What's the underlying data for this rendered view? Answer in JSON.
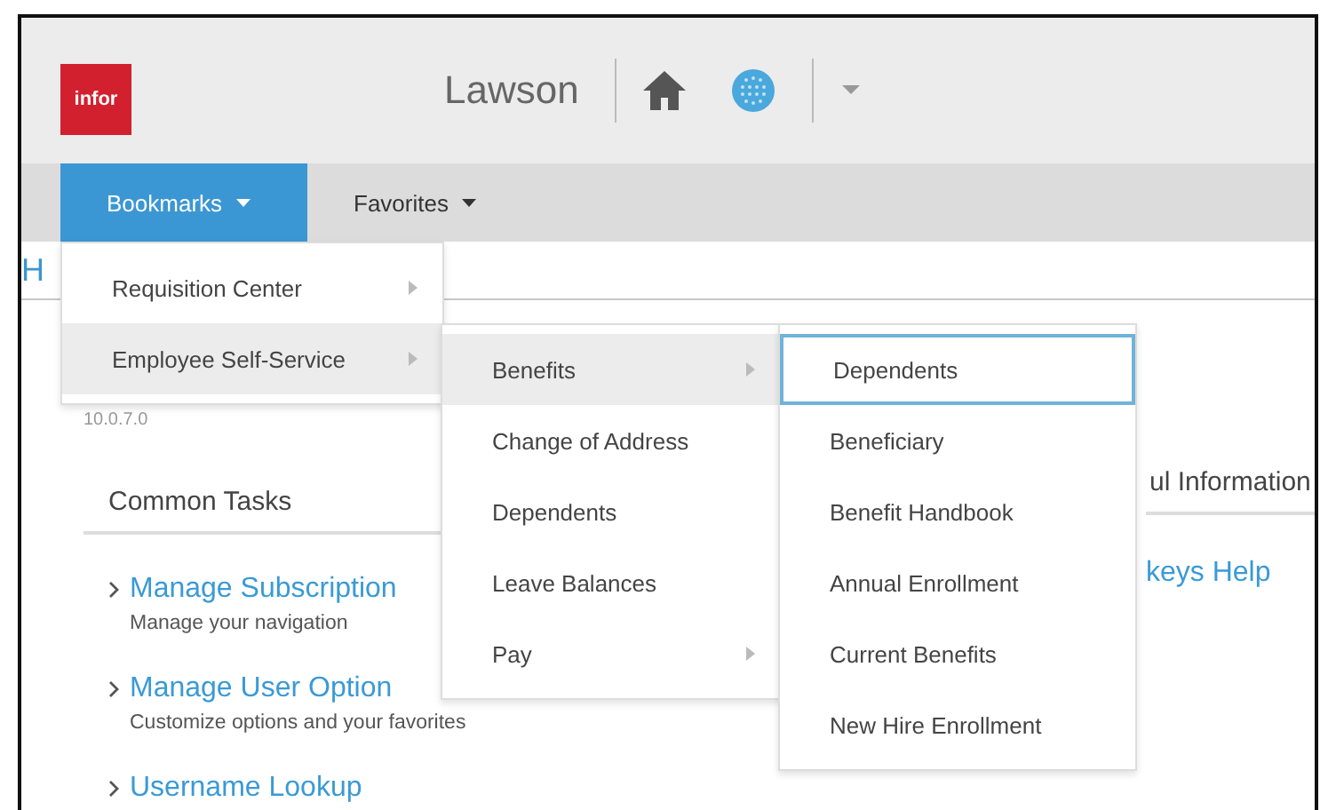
{
  "header": {
    "logo": "infor",
    "title": "Lawson"
  },
  "nav": {
    "tabs": [
      {
        "label": "Bookmarks",
        "selected": true
      },
      {
        "label": "Favorites",
        "selected": false
      }
    ]
  },
  "breadcrumb": "H",
  "content": {
    "version": "10.0.7.0",
    "left": {
      "heading": "Common Tasks",
      "links": [
        {
          "title": "Manage Subscription",
          "description": "Manage your navigation"
        },
        {
          "title": "Manage User Option",
          "description": "Customize options and your favorites"
        },
        {
          "title": "Username Lookup"
        }
      ]
    },
    "right": {
      "heading": "ul Information",
      "links": [
        {
          "title": "keys Help"
        }
      ]
    }
  },
  "menus": [
    {
      "items": [
        {
          "label": "Requisition Center",
          "has_submenu": true,
          "selected": false
        },
        {
          "label": "Employee Self-Service",
          "has_submenu": true,
          "selected": true
        }
      ]
    },
    {
      "items": [
        {
          "label": "Benefits",
          "has_submenu": true,
          "selected": true
        },
        {
          "label": "Change of Address",
          "has_submenu": false,
          "selected": false
        },
        {
          "label": "Dependents",
          "has_submenu": false,
          "selected": false
        },
        {
          "label": "Leave Balances",
          "has_submenu": false,
          "selected": false
        },
        {
          "label": "Pay",
          "has_submenu": true,
          "selected": false
        }
      ]
    },
    {
      "items": [
        {
          "label": "Dependents",
          "focused": true
        },
        {
          "label": "Beneficiary",
          "focused": false
        },
        {
          "label": "Benefit Handbook",
          "focused": false
        },
        {
          "label": "Annual Enrollment",
          "focused": false
        },
        {
          "label": "Current Benefits",
          "focused": false
        },
        {
          "label": "New Hire Enrollment",
          "focused": false
        }
      ]
    }
  ]
}
